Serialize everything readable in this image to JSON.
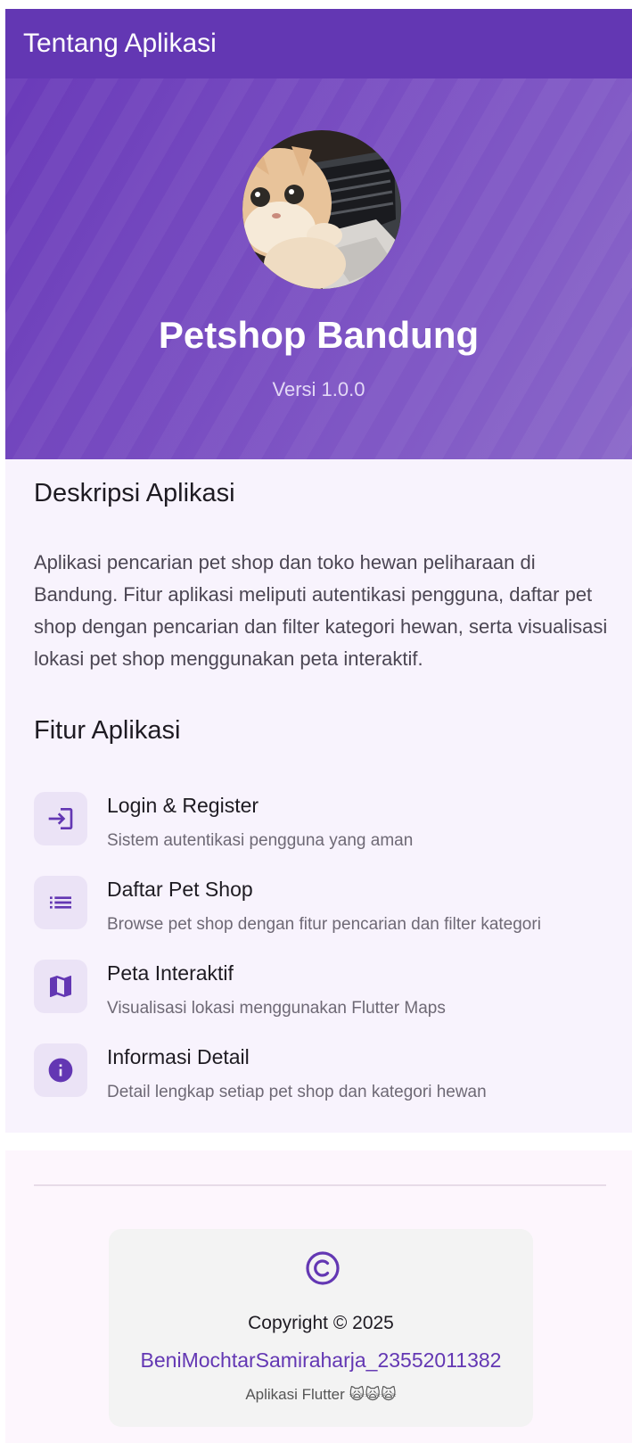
{
  "appbar": {
    "title": "Tentang Aplikasi"
  },
  "hero": {
    "app_name": "Petshop Bandung",
    "version": "Versi 1.0.0",
    "avatar_icon": "cat-photo",
    "gradient_colors": [
      "#6a3bb9",
      "#8a67c9"
    ]
  },
  "description": {
    "heading": "Deskripsi Aplikasi",
    "text": "Aplikasi pencarian pet shop dan toko hewan peliharaan di Bandung. Fitur aplikasi meliputi autentikasi pengguna, daftar pet shop dengan pencarian dan filter kategori hewan, serta visualisasi lokasi pet shop menggunakan peta interaktif."
  },
  "features": {
    "heading": "Fitur Aplikasi",
    "items": [
      {
        "icon": "login-icon",
        "title": "Login & Register",
        "subtitle": "Sistem autentikasi pengguna yang aman"
      },
      {
        "icon": "list-icon",
        "title": "Daftar Pet Shop",
        "subtitle": "Browse pet shop dengan fitur pencarian dan filter kategori"
      },
      {
        "icon": "map-icon",
        "title": "Peta Interaktif",
        "subtitle": "Visualisasi lokasi menggunakan Flutter Maps"
      },
      {
        "icon": "info-icon",
        "title": "Informasi Detail",
        "subtitle": "Detail lengkap setiap pet shop dan kategori hewan"
      }
    ]
  },
  "footer": {
    "copyright": "Copyright © 2025",
    "author": "BeniMochtarSamiraharja_23552011382",
    "note": "Aplikasi Flutter 🙀🙀🙀",
    "icon": "copyright-icon"
  },
  "colors": {
    "primary": "#6337b3",
    "accent": "#6a3bb9",
    "surface": "#f8f3fd"
  }
}
